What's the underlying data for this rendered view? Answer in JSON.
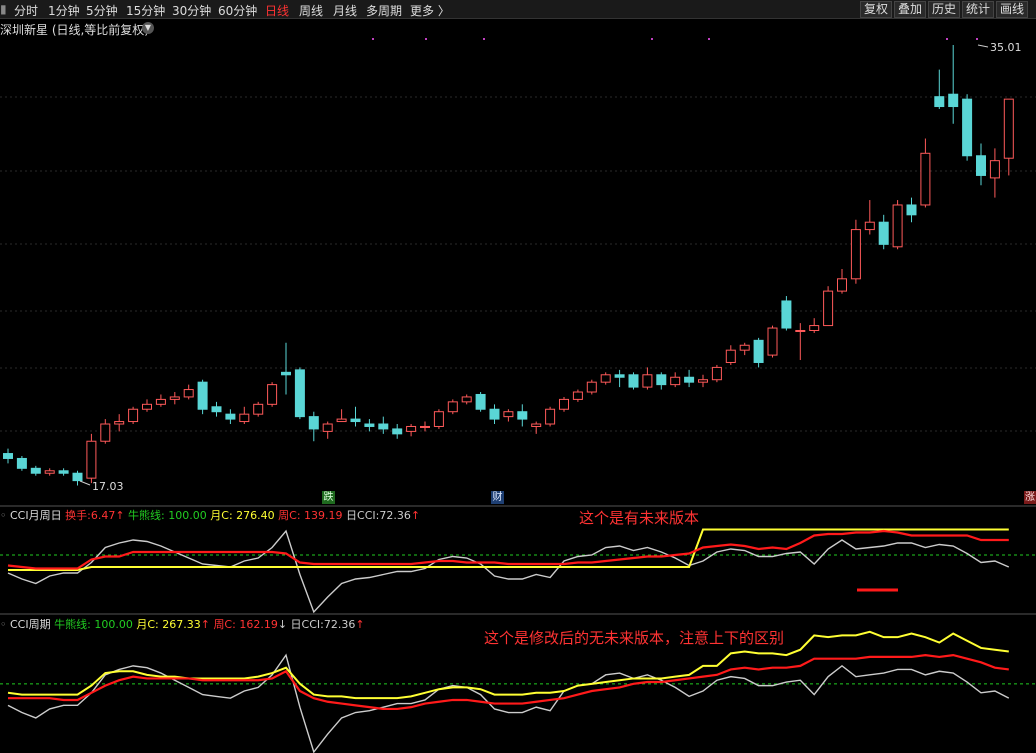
{
  "toolbar": {
    "periods": [
      "分时",
      "1分钟",
      "5分钟",
      "15分钟",
      "30分钟",
      "60分钟",
      "日线",
      "周线",
      "月线",
      "多周期",
      "更多 〉"
    ],
    "active_period": "日线",
    "right_buttons": [
      "复权",
      "叠加",
      "历史",
      "统计",
      "画线"
    ]
  },
  "stock": {
    "title": "深圳新星 (日线,等比前复权)"
  },
  "price": {
    "high_label": "35.01",
    "low_label": "17.03"
  },
  "badges": {
    "die": "跌",
    "cai": "财",
    "zhang": "涨"
  },
  "colors": {
    "up": "#ff5a5a",
    "down": "#5ad6d6",
    "red_line": "#ff1a1a",
    "yellow_line": "#ffff33",
    "white_line": "#cccccc",
    "green_text": "#22cc22"
  },
  "indicator1": {
    "name": "CCI月周日",
    "huanshou_label": "换手:",
    "huanshou_value": "6.47",
    "niuxiong_label": "牛熊线:",
    "niuxiong_value": "100.00",
    "yue_label": "月C:",
    "yue_value": "276.40",
    "zhou_label": "周C:",
    "zhou_value": "139.19",
    "ri_label": "日CCI:",
    "ri_value": "72.36",
    "arrow_up": "↑"
  },
  "indicator2": {
    "name": "CCI周期",
    "niuxiong_label": "牛熊线:",
    "niuxiong_value": "100.00",
    "yue_label": "月C:",
    "yue_value": "267.33",
    "zhou_label": "周C:",
    "zhou_value": "162.19",
    "ri_label": "日CCI:",
    "ri_value": "72.36",
    "arrow_up": "↑",
    "arrow_down": "↓"
  },
  "annotations": {
    "top": "这个是有未来版本",
    "bottom": "这个是修改后的无未来版本，注意上下的区别"
  },
  "chart_data": {
    "type": "candlestick",
    "candles": [
      [
        18.4,
        18.6,
        18.2,
        18.0
      ],
      [
        18.2,
        18.3,
        17.8,
        17.7
      ],
      [
        17.8,
        17.9,
        17.6,
        17.5
      ],
      [
        17.6,
        17.8,
        17.7,
        17.5
      ],
      [
        17.7,
        17.8,
        17.6,
        17.5
      ],
      [
        17.6,
        17.7,
        17.3,
        17.1
      ],
      [
        17.4,
        19.2,
        18.9,
        17.2
      ],
      [
        18.9,
        19.8,
        19.6,
        18.8
      ],
      [
        19.6,
        20.0,
        19.7,
        19.3
      ],
      [
        19.7,
        20.3,
        20.2,
        19.6
      ],
      [
        20.2,
        20.6,
        20.4,
        20.1
      ],
      [
        20.4,
        20.8,
        20.6,
        20.3
      ],
      [
        20.6,
        20.9,
        20.7,
        20.4
      ],
      [
        20.7,
        21.2,
        21.0,
        20.6
      ],
      [
        21.3,
        21.4,
        20.2,
        20.0
      ],
      [
        20.3,
        20.5,
        20.1,
        19.9
      ],
      [
        20.0,
        20.2,
        19.8,
        19.6
      ],
      [
        19.7,
        20.3,
        20.0,
        19.6
      ],
      [
        20.0,
        20.5,
        20.4,
        19.9
      ],
      [
        20.4,
        21.3,
        21.2,
        20.3
      ],
      [
        21.7,
        22.9,
        21.6,
        20.8
      ],
      [
        21.8,
        21.9,
        19.9,
        19.8
      ],
      [
        19.9,
        20.1,
        19.4,
        18.9
      ],
      [
        19.3,
        19.7,
        19.6,
        19.0
      ],
      [
        19.7,
        20.2,
        19.8,
        19.7
      ],
      [
        19.8,
        20.3,
        19.7,
        19.5
      ],
      [
        19.6,
        19.8,
        19.5,
        19.3
      ],
      [
        19.6,
        19.9,
        19.4,
        19.2
      ],
      [
        19.4,
        19.6,
        19.2,
        19.0
      ],
      [
        19.3,
        19.6,
        19.5,
        19.1
      ],
      [
        19.5,
        19.7,
        19.5,
        19.3
      ],
      [
        19.5,
        20.2,
        20.1,
        19.4
      ],
      [
        20.1,
        20.6,
        20.5,
        20.0
      ],
      [
        20.5,
        20.8,
        20.7,
        20.4
      ],
      [
        20.8,
        20.9,
        20.2,
        20.1
      ],
      [
        20.2,
        20.4,
        19.8,
        19.6
      ],
      [
        19.9,
        20.2,
        20.1,
        19.7
      ],
      [
        20.1,
        20.4,
        19.8,
        19.5
      ],
      [
        19.5,
        19.7,
        19.6,
        19.2
      ],
      [
        19.6,
        20.3,
        20.2,
        19.5
      ],
      [
        20.2,
        20.7,
        20.6,
        20.1
      ],
      [
        20.6,
        21.0,
        20.9,
        20.5
      ],
      [
        20.9,
        21.4,
        21.3,
        20.8
      ],
      [
        21.3,
        21.7,
        21.6,
        21.2
      ],
      [
        21.6,
        21.8,
        21.5,
        21.1
      ],
      [
        21.6,
        21.7,
        21.1,
        21.0
      ],
      [
        21.1,
        21.9,
        21.6,
        21.0
      ],
      [
        21.6,
        21.7,
        21.2,
        21.0
      ],
      [
        21.2,
        21.7,
        21.5,
        21.1
      ],
      [
        21.5,
        21.8,
        21.3,
        21.1
      ],
      [
        21.3,
        21.6,
        21.4,
        21.1
      ],
      [
        21.4,
        22.0,
        21.9,
        21.3
      ],
      [
        22.1,
        22.8,
        22.6,
        22.0
      ],
      [
        22.6,
        22.9,
        22.8,
        22.4
      ],
      [
        23.0,
        23.1,
        22.1,
        21.9
      ],
      [
        22.4,
        23.6,
        23.5,
        22.3
      ],
      [
        24.6,
        24.8,
        23.5,
        23.4
      ],
      [
        23.4,
        23.7,
        23.4,
        22.2
      ],
      [
        23.4,
        23.9,
        23.6,
        23.3
      ],
      [
        23.6,
        25.2,
        25.0,
        23.6
      ],
      [
        25.0,
        25.9,
        25.5,
        24.9
      ],
      [
        25.5,
        27.9,
        27.5,
        25.3
      ],
      [
        27.5,
        28.7,
        27.8,
        27.3
      ],
      [
        27.8,
        28.1,
        26.9,
        26.7
      ],
      [
        26.8,
        28.7,
        28.5,
        26.7
      ],
      [
        28.5,
        28.8,
        28.1,
        27.8
      ],
      [
        28.5,
        31.2,
        30.6,
        28.4
      ],
      [
        32.9,
        34.0,
        32.5,
        32.4
      ],
      [
        33.0,
        35.0,
        32.5,
        31.8
      ],
      [
        32.8,
        33.0,
        30.5,
        30.3
      ],
      [
        30.5,
        31.0,
        29.7,
        29.3
      ],
      [
        29.6,
        30.8,
        30.3,
        28.8
      ],
      [
        30.4,
        32.8,
        32.8,
        29.7
      ]
    ],
    "indicator1": {
      "niuxiong": 100,
      "yue": [
        0,
        0,
        0,
        0,
        0,
        0,
        20,
        20,
        20,
        20,
        20,
        20,
        20,
        20,
        20,
        20,
        20,
        20,
        20,
        20,
        20,
        20,
        20,
        20,
        20,
        20,
        20,
        20,
        20,
        20,
        20,
        20,
        20,
        20,
        20,
        20,
        20,
        20,
        20,
        20,
        20,
        20,
        20,
        20,
        20,
        20,
        20,
        20,
        20,
        20,
        270,
        270,
        270,
        270,
        270,
        270,
        270,
        270,
        270,
        270,
        270,
        270,
        270,
        270,
        270,
        270,
        270,
        270,
        270,
        270,
        270,
        270,
        270
      ],
      "zhou": [
        30,
        20,
        10,
        10,
        10,
        10,
        70,
        90,
        90,
        120,
        120,
        120,
        120,
        120,
        120,
        120,
        120,
        120,
        120,
        120,
        110,
        50,
        40,
        40,
        40,
        40,
        40,
        40,
        40,
        40,
        50,
        60,
        60,
        50,
        50,
        50,
        40,
        40,
        40,
        40,
        40,
        50,
        50,
        60,
        70,
        80,
        90,
        90,
        100,
        110,
        150,
        160,
        170,
        160,
        140,
        150,
        140,
        180,
        230,
        240,
        240,
        250,
        250,
        260,
        250,
        230,
        230,
        230,
        230,
        230,
        200,
        200,
        200
      ],
      "ri": [
        -20,
        -60,
        -90,
        -40,
        -20,
        -20,
        50,
        150,
        180,
        200,
        190,
        160,
        120,
        80,
        40,
        30,
        20,
        60,
        80,
        150,
        260,
        -30,
        -280,
        -180,
        -90,
        -60,
        -50,
        -30,
        -10,
        -10,
        10,
        70,
        90,
        80,
        40,
        -40,
        -60,
        -60,
        -30,
        -50,
        60,
        90,
        100,
        150,
        160,
        130,
        150,
        120,
        80,
        30,
        60,
        120,
        140,
        130,
        90,
        90,
        110,
        120,
        40,
        140,
        200,
        140,
        150,
        160,
        180,
        180,
        150,
        170,
        160,
        110,
        50,
        60,
        20
      ]
    },
    "indicator2": {
      "niuxiong": 100,
      "yue": [
        50,
        40,
        40,
        40,
        40,
        40,
        90,
        160,
        170,
        170,
        150,
        140,
        140,
        130,
        130,
        130,
        130,
        130,
        140,
        160,
        190,
        100,
        40,
        30,
        30,
        20,
        20,
        20,
        20,
        30,
        50,
        70,
        80,
        80,
        70,
        40,
        40,
        40,
        50,
        50,
        60,
        90,
        100,
        110,
        120,
        130,
        130,
        130,
        140,
        150,
        200,
        200,
        270,
        280,
        270,
        270,
        260,
        290,
        370,
        360,
        370,
        370,
        390,
        360,
        360,
        380,
        360,
        330,
        380,
        340,
        300,
        290,
        280
      ],
      "zhou": [
        20,
        20,
        20,
        20,
        10,
        10,
        50,
        90,
        120,
        140,
        130,
        130,
        130,
        130,
        120,
        120,
        120,
        120,
        120,
        130,
        170,
        60,
        20,
        0,
        -10,
        -20,
        -30,
        -40,
        -40,
        -30,
        -10,
        0,
        10,
        10,
        0,
        -10,
        -10,
        -10,
        0,
        10,
        20,
        40,
        60,
        70,
        80,
        100,
        110,
        110,
        120,
        130,
        140,
        150,
        180,
        190,
        180,
        190,
        190,
        200,
        240,
        240,
        240,
        240,
        250,
        250,
        250,
        250,
        260,
        250,
        260,
        240,
        220,
        190,
        180
      ],
      "ri": [
        -20,
        -60,
        -90,
        -40,
        -20,
        -20,
        50,
        150,
        180,
        200,
        190,
        160,
        120,
        80,
        40,
        30,
        20,
        60,
        80,
        150,
        260,
        -30,
        -280,
        -180,
        -90,
        -60,
        -50,
        -30,
        -10,
        -10,
        10,
        70,
        90,
        80,
        40,
        -40,
        -60,
        -60,
        -30,
        -50,
        60,
        90,
        100,
        150,
        160,
        130,
        150,
        120,
        80,
        30,
        60,
        120,
        140,
        130,
        90,
        90,
        110,
        120,
        40,
        140,
        200,
        140,
        150,
        160,
        180,
        180,
        150,
        170,
        160,
        110,
        50,
        60,
        20
      ]
    }
  }
}
